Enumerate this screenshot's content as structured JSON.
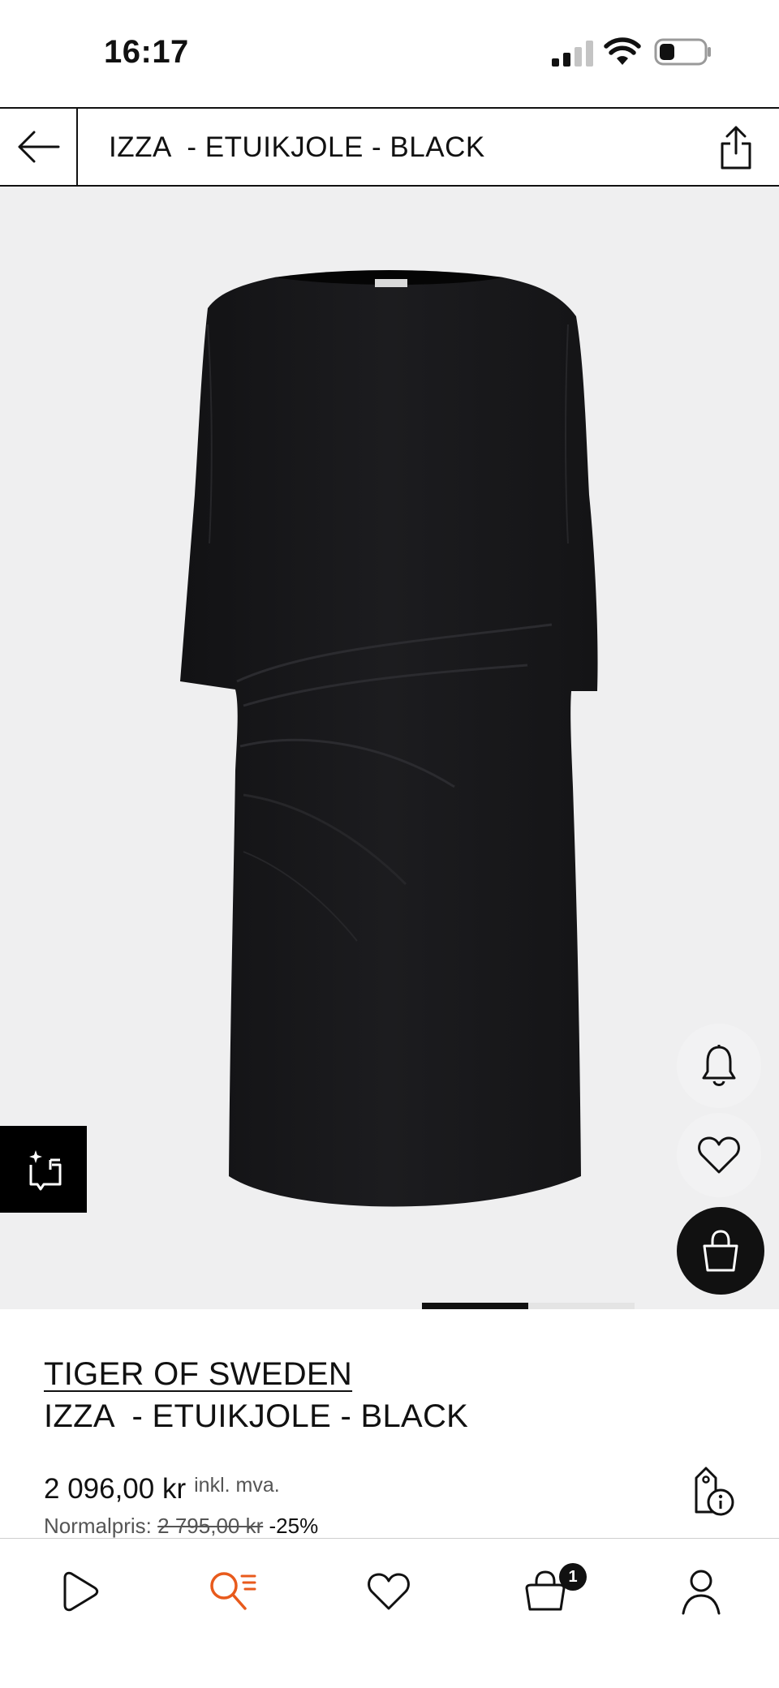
{
  "status_bar": {
    "time": "16:17",
    "signal_icon": "cellular-signal-icon",
    "wifi_icon": "wifi-icon",
    "battery_icon": "battery-icon"
  },
  "header": {
    "title": "IZZA  - ETUIKJOLE - BLACK",
    "back_icon": "arrow-left-icon",
    "share_icon": "share-icon"
  },
  "product_image": {
    "description_icon": "dress-image",
    "background_color": "#efeff0",
    "carousel": {
      "total": 2,
      "active": 1
    }
  },
  "actions": {
    "notify_icon": "bell-icon",
    "wishlist_icon": "heart-icon",
    "bag_icon": "shopping-bag-icon",
    "tryon_icon": "size-compare-icon"
  },
  "product": {
    "brand": "TIGER OF SWEDEN",
    "name": "IZZA  - ETUIKJOLE - BLACK",
    "price": "2 096,00 kr",
    "vat_note": "inkl. mva.",
    "normal_label": "Normalpris:",
    "normal_price": "2 795,00 kr",
    "discount": "-25%",
    "price_info_icon": "price-tag-info-icon"
  },
  "bottom_nav": {
    "items": [
      {
        "name": "home",
        "icon": "play-logo-icon",
        "active": false
      },
      {
        "name": "search",
        "icon": "search-list-icon",
        "active": true
      },
      {
        "name": "wishlist",
        "icon": "heart-icon",
        "active": false
      },
      {
        "name": "bag",
        "icon": "shopping-bag-icon",
        "active": false,
        "badge": "1"
      },
      {
        "name": "account",
        "icon": "person-icon",
        "active": false
      }
    ],
    "active_color": "#e85a1c"
  }
}
